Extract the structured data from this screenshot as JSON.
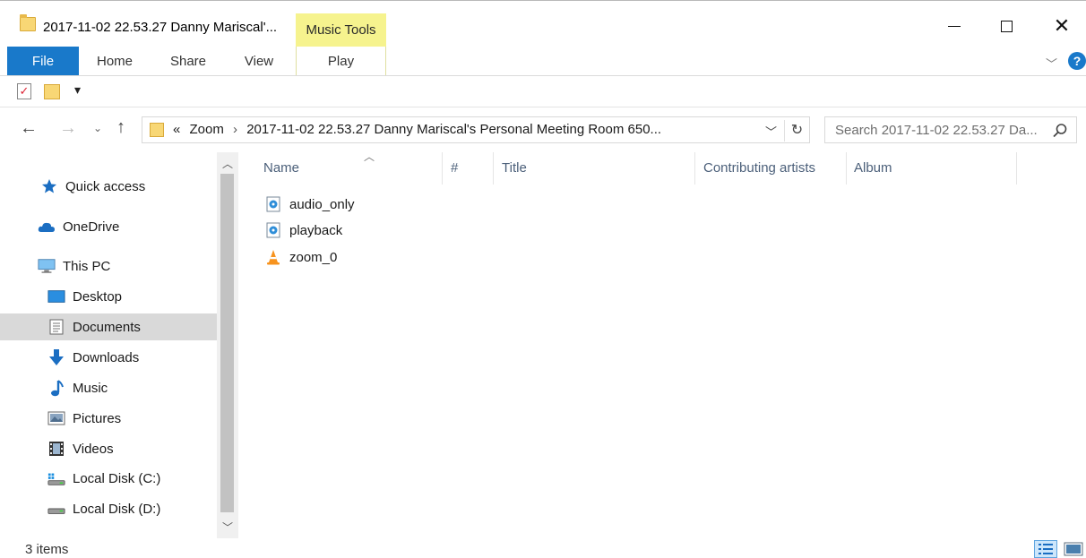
{
  "window": {
    "title": "2017-11-02 22.53.27 Danny Mariscal'...",
    "context_tab_group": "Music Tools"
  },
  "ribbon": {
    "tabs": [
      "File",
      "Home",
      "Share",
      "View",
      "Play"
    ],
    "file_color": "#1979ca",
    "context_color": "#f6f38e"
  },
  "address": {
    "overflow": "«",
    "crumbs": [
      "Zoom",
      "2017-11-02 22.53.27 Danny Mariscal's Personal Meeting Room 650..."
    ],
    "separator": "›"
  },
  "search": {
    "placeholder": "Search 2017-11-02 22.53.27 Da..."
  },
  "nav_pane": {
    "items": [
      {
        "label": "Quick access",
        "icon": "star-icon"
      },
      {
        "label": "OneDrive",
        "icon": "cloud-icon"
      },
      {
        "label": "This PC",
        "icon": "computer-icon"
      },
      {
        "label": "Desktop",
        "icon": "desktop-icon"
      },
      {
        "label": "Documents",
        "icon": "documents-icon",
        "selected": true
      },
      {
        "label": "Downloads",
        "icon": "download-arrow-icon"
      },
      {
        "label": "Music",
        "icon": "music-note-icon"
      },
      {
        "label": "Pictures",
        "icon": "pictures-icon"
      },
      {
        "label": "Videos",
        "icon": "film-icon"
      },
      {
        "label": "Local Disk (C:)",
        "icon": "windows-drive-icon"
      },
      {
        "label": "Local Disk (D:)",
        "icon": "drive-icon"
      }
    ]
  },
  "columns": [
    "Name",
    "#",
    "Title",
    "Contributing artists",
    "Album"
  ],
  "files": [
    {
      "name": "audio_only",
      "icon": "audio-file-icon"
    },
    {
      "name": "playback",
      "icon": "audio-file-icon"
    },
    {
      "name": "zoom_0",
      "icon": "vlc-cone-icon"
    }
  ],
  "status": {
    "item_count": "3 items"
  }
}
